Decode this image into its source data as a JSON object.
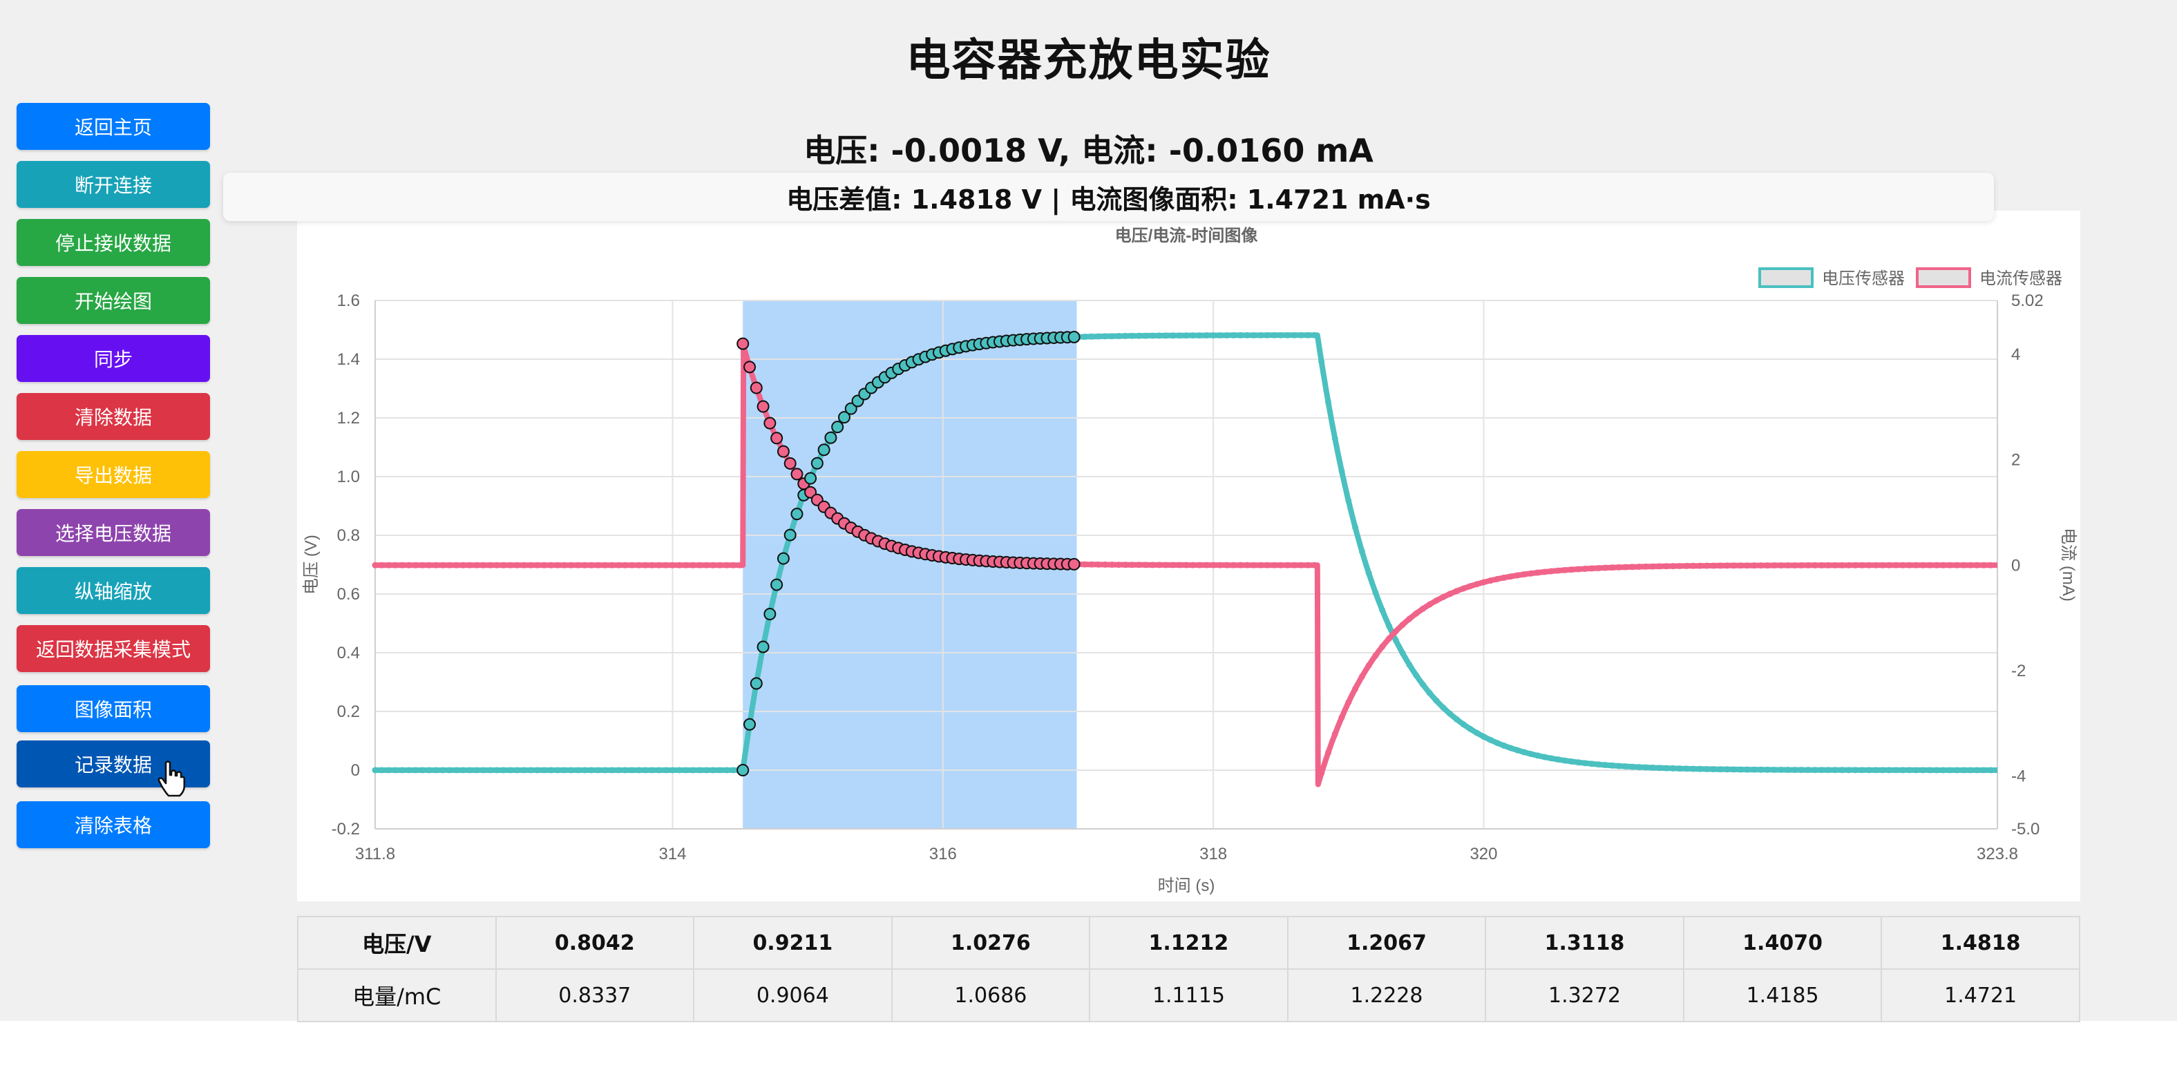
{
  "page_title": "电容器充放电实验",
  "sidebar": {
    "buttons": [
      {
        "label": "返回主页",
        "color": "#007bff"
      },
      {
        "label": "断开连接",
        "color": "#17a2b8"
      },
      {
        "label": "停止接收数据",
        "color": "#28a745"
      },
      {
        "label": "开始绘图",
        "color": "#28a745"
      },
      {
        "label": "同步",
        "color": "#6610f2"
      },
      {
        "label": "清除数据",
        "color": "#dc3545"
      },
      {
        "label": "导出数据",
        "color": "#ffc107"
      },
      {
        "label": "选择电压数据",
        "color": "#8e44ad"
      },
      {
        "label": "纵轴缩放",
        "color": "#17a2b8"
      },
      {
        "label": "返回数据采集模式",
        "color": "#dc3545"
      },
      {
        "label": "图像面积",
        "color": "#007bff"
      },
      {
        "label": "记录数据",
        "color": "#0056b3"
      },
      {
        "label": "清除表格",
        "color": "#007bff"
      }
    ]
  },
  "readout": "电压: -0.0018 V, 电流: -0.0160 mA",
  "diff_panel": "电压差值: 1.4818 V | 电流图像面积: 1.4721 mA·s",
  "chart_data": {
    "type": "line",
    "title": "电压/电流-时间图像",
    "xlabel": "时间 (s)",
    "ylabel_left": "电压 (V)",
    "ylabel_right": "电流 (mA)",
    "xlim": [
      311.8,
      323.8
    ],
    "ylim_left": [
      -0.2,
      1.6
    ],
    "ylim_right": [
      -5.0,
      5.02
    ],
    "x_ticks": [
      "311.8",
      "314",
      "316",
      "318",
      "320",
      "323.8"
    ],
    "x_tick_values": [
      311.8,
      314,
      316,
      318,
      320,
      323.8
    ],
    "y_left_ticks": [
      "-0.2",
      "0",
      "0.2",
      "0.4",
      "0.6",
      "0.8",
      "1.0",
      "1.2",
      "1.4",
      "1.6"
    ],
    "y_left_tick_values": [
      -0.2,
      0,
      0.2,
      0.4,
      0.6,
      0.8,
      1.0,
      1.2,
      1.4,
      1.6
    ],
    "y_right_ticks": [
      "-5.0",
      "-4",
      "-2",
      "0",
      "2",
      "4",
      "5.02"
    ],
    "y_right_tick_values": [
      -5.0,
      -4,
      -2,
      0,
      2,
      4,
      5.02
    ],
    "grid": true,
    "legend_position": "top-right",
    "selection": {
      "x_start": 314.52,
      "x_end": 316.99,
      "color": "#b3d7fb"
    },
    "series": [
      {
        "name": "电压传感器",
        "axis": "left",
        "color": "#4bc0c0",
        "charge_start": 314.52,
        "charge_tau": 0.45,
        "v_max": 1.4818,
        "discharge_start": 318.77,
        "discharge_tau": 0.48
      },
      {
        "name": "电流传感器",
        "axis": "right",
        "color": "#f0648a",
        "charge_start": 314.52,
        "charge_peak": 4.2,
        "charge_tau": 0.45,
        "discharge_start": 318.77,
        "discharge_peak": -4.2,
        "discharge_tau": 0.48
      }
    ]
  },
  "table": {
    "rows": [
      {
        "header": "电压/V",
        "values": [
          "0.8042",
          "0.9211",
          "1.0276",
          "1.1212",
          "1.2067",
          "1.3118",
          "1.4070",
          "1.4818"
        ]
      },
      {
        "header": "电量/mC",
        "values": [
          "0.8337",
          "0.9064",
          "1.0686",
          "1.1115",
          "1.2228",
          "1.3272",
          "1.4185",
          "1.4721"
        ]
      }
    ]
  }
}
